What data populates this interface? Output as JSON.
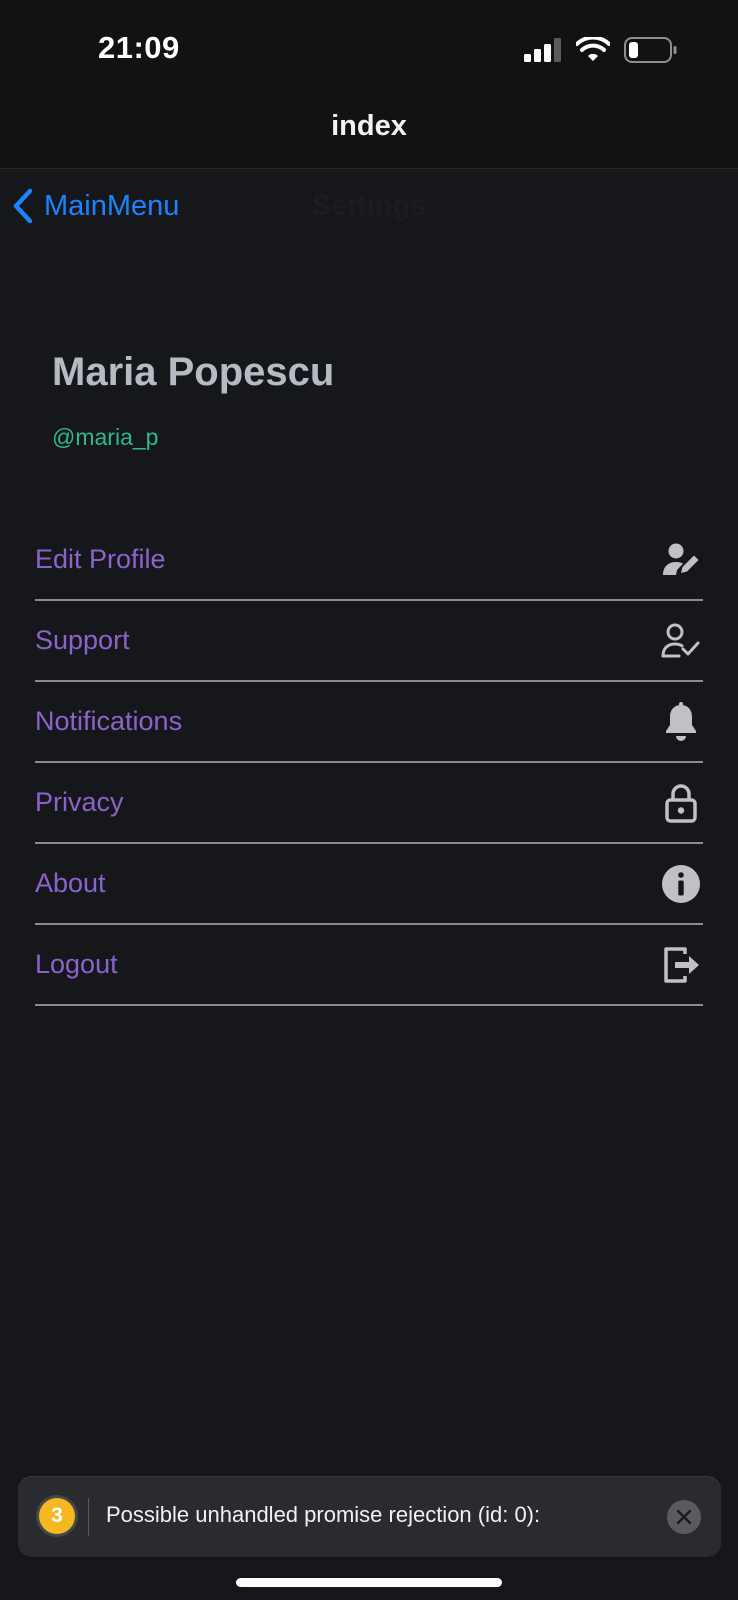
{
  "status_bar": {
    "time": "21:09"
  },
  "header": {
    "title": "index"
  },
  "nav": {
    "back_label": "MainMenu",
    "title": "Settings"
  },
  "profile": {
    "name": "Maria Popescu",
    "handle": "@maria_p"
  },
  "menu": {
    "items": [
      {
        "label": "Edit Profile",
        "icon": "user-edit-icon"
      },
      {
        "label": "Support",
        "icon": "user-check-icon"
      },
      {
        "label": "Notifications",
        "icon": "bell-icon"
      },
      {
        "label": "Privacy",
        "icon": "lock-icon"
      },
      {
        "label": "About",
        "icon": "info-icon"
      },
      {
        "label": "Logout",
        "icon": "logout-icon"
      }
    ]
  },
  "toast": {
    "count": "3",
    "message": "Possible unhandled promise rejection (id: 0):"
  },
  "colors": {
    "background": "#16171a",
    "accent_link": "#1a84ff",
    "menu_label": "#8c62cc",
    "handle": "#2fb88a",
    "name": "#b4bbc2",
    "warning_badge": "#f5b820"
  }
}
